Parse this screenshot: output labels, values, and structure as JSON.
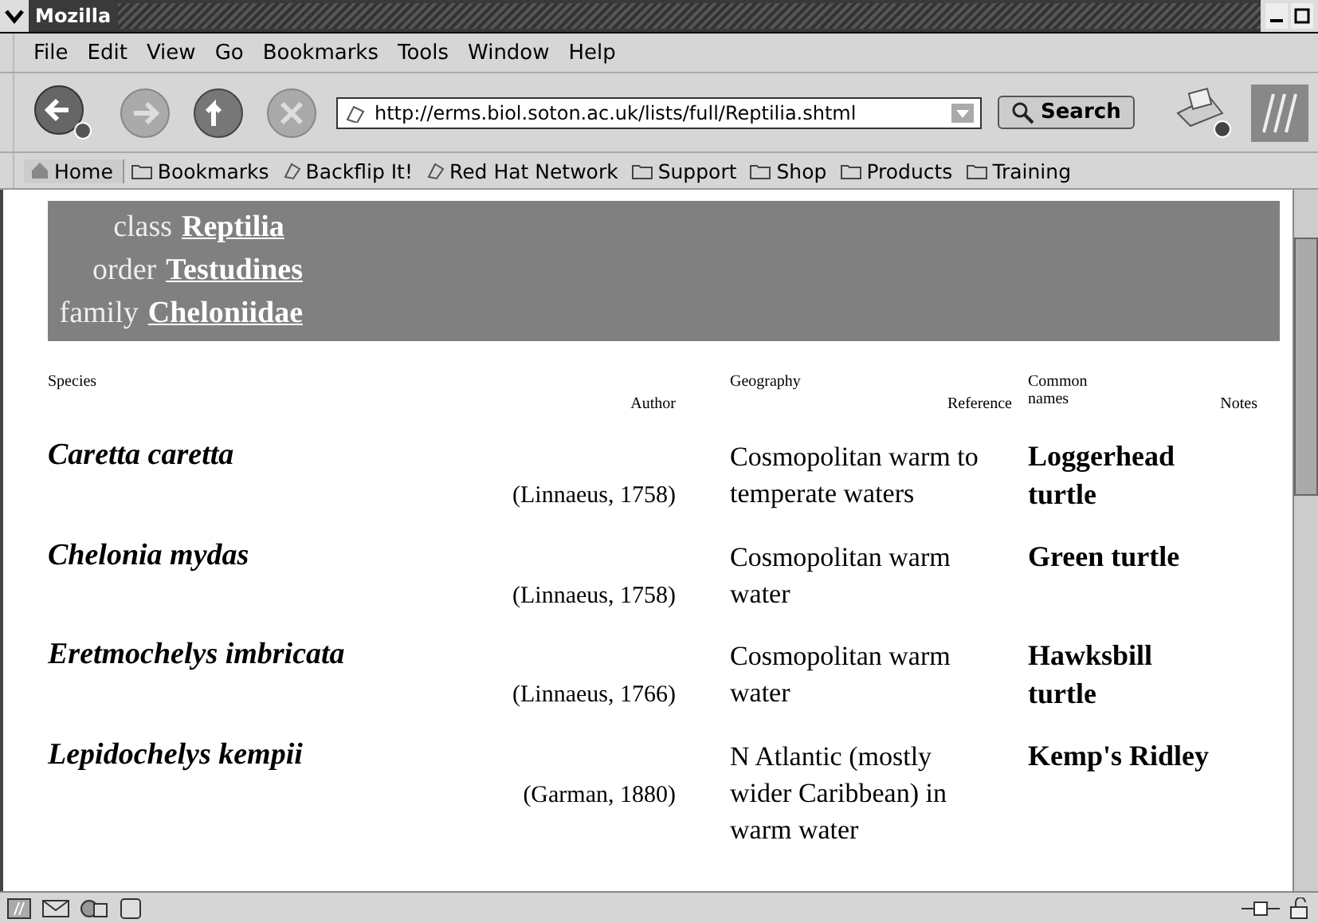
{
  "window": {
    "title": "Mozilla"
  },
  "menu": [
    "File",
    "Edit",
    "View",
    "Go",
    "Bookmarks",
    "Tools",
    "Window",
    "Help"
  ],
  "address": {
    "value": "http://erms.biol.soton.ac.uk/lists/full/Reptilia.shtml"
  },
  "search_button": "Search",
  "bookmarks": [
    {
      "kind": "home",
      "label": "Home"
    },
    {
      "kind": "folder",
      "label": "Bookmarks"
    },
    {
      "kind": "link",
      "label": "Backflip It!"
    },
    {
      "kind": "link",
      "label": "Red Hat Network"
    },
    {
      "kind": "folder",
      "label": "Support"
    },
    {
      "kind": "folder",
      "label": "Shop"
    },
    {
      "kind": "folder",
      "label": "Products"
    },
    {
      "kind": "folder",
      "label": "Training"
    }
  ],
  "taxonomy": [
    {
      "rank": "class",
      "name": "Reptilia"
    },
    {
      "rank": "order",
      "name": "Testudines"
    },
    {
      "rank": "family",
      "name": "Cheloniidae"
    }
  ],
  "table": {
    "columns": [
      "Species",
      "Author",
      "Geography",
      "Reference",
      "Common names",
      "Notes"
    ],
    "rows": [
      {
        "species": "Caretta caretta",
        "author": "(Linnaeus, 1758)",
        "geography": "Cosmopolitan warm to temperate waters",
        "common": "Loggerhead turtle"
      },
      {
        "species": "Chelonia mydas",
        "author": "(Linnaeus, 1758)",
        "geography": "Cosmopolitan warm water",
        "common": "Green turtle"
      },
      {
        "species": "Eretmochelys imbricata",
        "author": "(Linnaeus, 1766)",
        "geography": "Cosmopolitan warm water",
        "common": "Hawksbill turtle"
      },
      {
        "species": "Lepidochelys kempii",
        "author": "(Garman, 1880)",
        "geography": "N Atlantic (mostly wider Caribbean) in warm water",
        "common": "Kemp's Ridley"
      }
    ]
  }
}
